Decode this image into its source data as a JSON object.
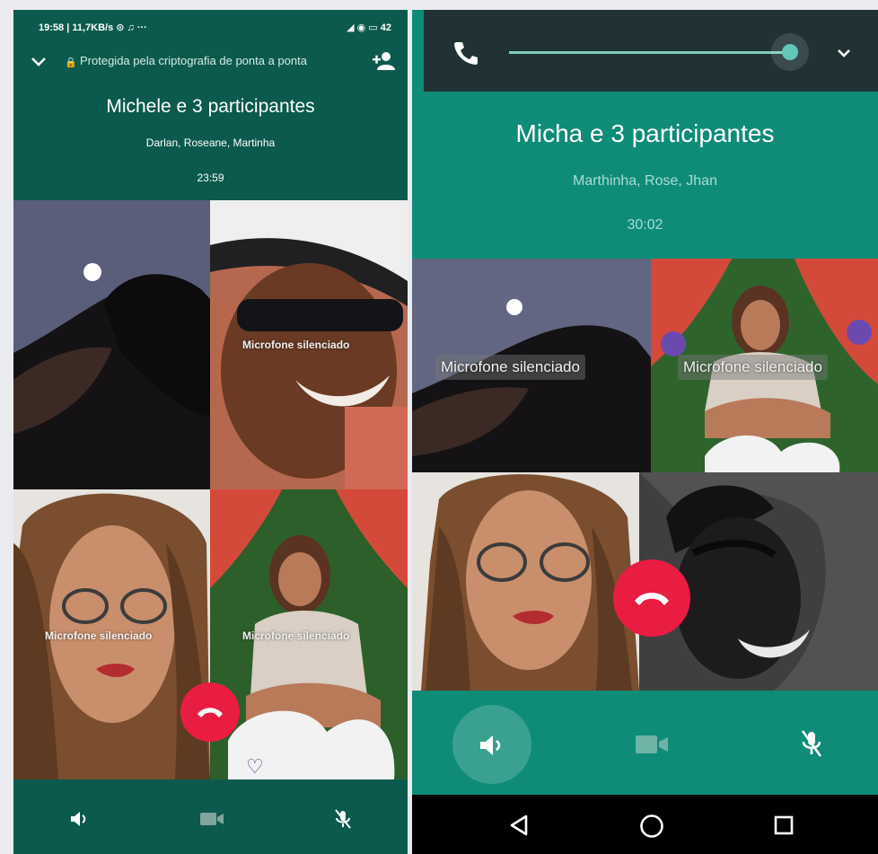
{
  "left_screen": {
    "status": {
      "left_text": "19:58 | 11,7KB/s ⊙ ♫ ···",
      "right_text": "◢ ◉ ▭ 42"
    },
    "encryption_text": "Protegida pela criptografia de ponta a ponta",
    "call_title": "Michele e 3 participantes",
    "participants": "Darlan, Roseane, Martinha",
    "timer": "23:59",
    "tiles": [
      {
        "muted_label": ""
      },
      {
        "muted_label": "Microfone silenciado"
      },
      {
        "muted_label": "Microfone silenciado"
      },
      {
        "muted_label": "Microfone silenciado"
      }
    ],
    "controls": [
      "speaker-icon",
      "video-off-icon",
      "mic-off-icon"
    ]
  },
  "right_screen": {
    "call_title": "Micha e 3 participantes",
    "participants": "Marthinha, Rose, Jhan",
    "timer": "30:02",
    "volume_level": 0.92,
    "tiles": [
      {
        "muted_label": "Microfone silenciado"
      },
      {
        "muted_label": "Microfone silenciado"
      },
      {
        "muted_label": ""
      },
      {
        "muted_label": ""
      }
    ],
    "controls": [
      "speaker-icon",
      "video-off-icon",
      "mic-off-icon"
    ],
    "nav": [
      "back-icon",
      "home-icon",
      "recents-icon"
    ]
  },
  "colors": {
    "header_dark": "#0c5a4d",
    "header_teal": "#0f8c78",
    "end_call": "#e91d41"
  }
}
